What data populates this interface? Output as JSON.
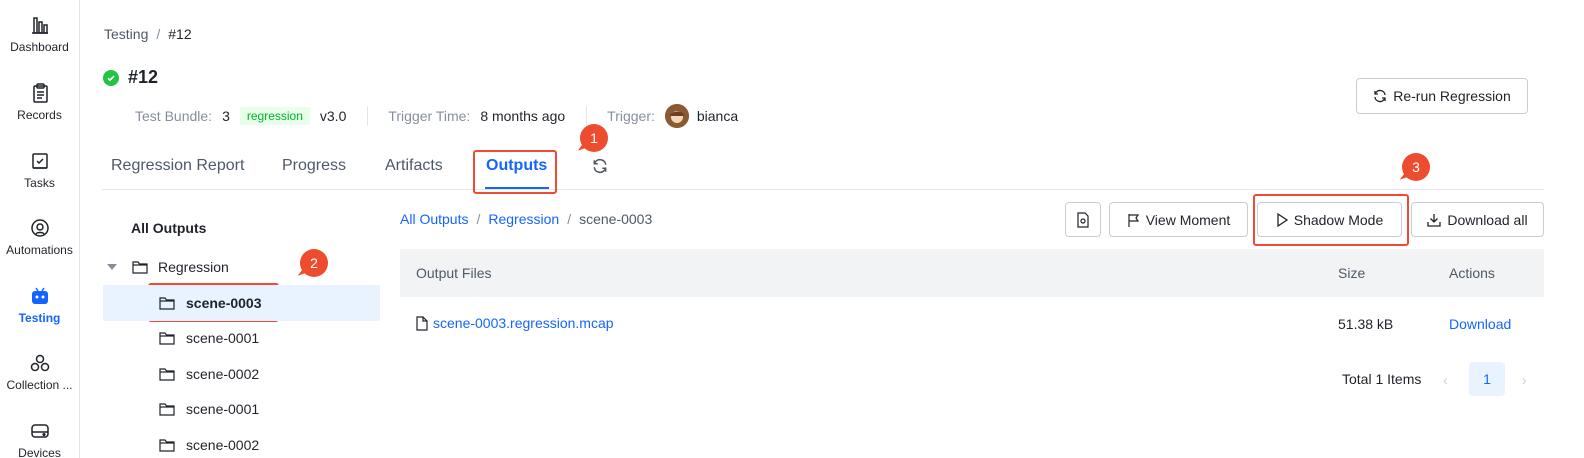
{
  "sidebar": {
    "items": [
      {
        "label": "Dashboard",
        "icon": "bar-chart-icon"
      },
      {
        "label": "Records",
        "icon": "clipboard-icon"
      },
      {
        "label": "Tasks",
        "icon": "task-check-icon"
      },
      {
        "label": "Automations",
        "icon": "automation-icon"
      },
      {
        "label": "Testing",
        "icon": "robot-test-icon",
        "active": true
      },
      {
        "label": "Collection ...",
        "icon": "collection-icon"
      },
      {
        "label": "Devices",
        "icon": "device-icon"
      }
    ]
  },
  "breadcrumb": {
    "root": "Testing",
    "current": "#12"
  },
  "header": {
    "title": "#12",
    "status": "success",
    "test_bundle_label": "Test Bundle:",
    "test_bundle_value": "3",
    "bundle_tag": "regression",
    "bundle_version": "v3.0",
    "trigger_time_label": "Trigger Time:",
    "trigger_time_value": "8 months ago",
    "trigger_label": "Trigger:",
    "trigger_user": "bianca",
    "rerun_label": "Re-run Regression"
  },
  "tabs": [
    {
      "label": "Regression Report"
    },
    {
      "label": "Progress"
    },
    {
      "label": "Artifacts"
    },
    {
      "label": "Outputs",
      "active": true
    }
  ],
  "markers": [
    "1",
    "2",
    "3"
  ],
  "tree": {
    "title": "All Outputs",
    "root": "Regression",
    "children": [
      "scene-0003",
      "scene-0001",
      "scene-0002",
      "scene-0001",
      "scene-0002"
    ],
    "selected_index": 0
  },
  "outputs_breadcrumb": {
    "root": "All Outputs",
    "middle": "Regression",
    "current": "scene-0003"
  },
  "toolbar": {
    "view_moment": "View Moment",
    "shadow_mode": "Shadow Mode",
    "download_all": "Download all"
  },
  "table": {
    "headers": [
      "Output Files",
      "Size",
      "Actions"
    ],
    "rows": [
      {
        "file": "scene-0003.regression.mcap",
        "size": "51.38 kB",
        "action": "Download"
      }
    ]
  },
  "pagination": {
    "total_text": "Total 1 Items",
    "current_page": "1"
  },
  "colors": {
    "accent": "#1664ff",
    "highlight": "#ed4c2e",
    "success": "#23c343"
  }
}
